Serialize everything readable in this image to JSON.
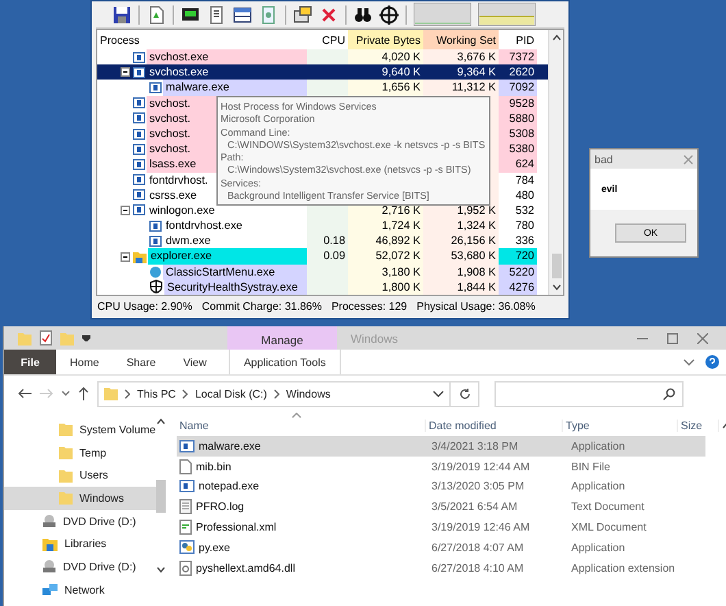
{
  "process_explorer": {
    "columns": [
      "Process",
      "CPU",
      "Private Bytes",
      "Working Set",
      "PID"
    ],
    "rows": [
      {
        "name": "svchost.exe",
        "private_bytes": "4,020 K",
        "working_set": "3,676 K",
        "pid": "7372",
        "kind": "app",
        "color": "#ffd0dc",
        "selected": false
      },
      {
        "name": "svchost.exe",
        "private_bytes": "9,640 K",
        "working_set": "9,364 K",
        "pid": "2620",
        "kind": "app",
        "selected": true,
        "expanded": true,
        "children": [
          {
            "name": "malware.exe",
            "private_bytes": "1,656 K",
            "working_set": "11,312 K",
            "pid": "7092",
            "kind": "app",
            "color": "#d4d4ff",
            "selected": false
          }
        ]
      },
      {
        "name": "svchost.",
        "pid": "9528",
        "kind": "app",
        "color": "#ffd0dc",
        "selected": false
      },
      {
        "name": "svchost.",
        "pid": "5880",
        "kind": "app",
        "color": "#ffd0dc",
        "selected": false
      },
      {
        "name": "svchost.",
        "pid": "5308",
        "kind": "app",
        "color": "#ffd0dc",
        "selected": false
      },
      {
        "name": "svchost.",
        "pid": "5380",
        "kind": "app",
        "color": "#ffd0dc",
        "selected": false
      },
      {
        "name": "lsass.exe",
        "pid": "624",
        "kind": "app",
        "color": "#ffd0dc",
        "selected": false
      },
      {
        "name": "fontdrvhost.",
        "pid": "784",
        "kind": "app",
        "selected": false
      },
      {
        "name": "csrss.exe",
        "pid": "480",
        "kind": "app",
        "selected": false
      },
      {
        "name": "winlogon.exe",
        "private_bytes": "2,716 K",
        "working_set": "1,952 K",
        "pid": "532",
        "kind": "app",
        "selected": false,
        "expanded": true,
        "children": [
          {
            "name": "fontdrvhost.exe",
            "private_bytes": "1,724 K",
            "working_set": "1,324 K",
            "pid": "780",
            "kind": "app",
            "selected": false
          },
          {
            "name": "dwm.exe",
            "cpu": "0.18",
            "private_bytes": "46,892 K",
            "working_set": "26,156 K",
            "pid": "336",
            "kind": "app",
            "selected": false
          }
        ]
      },
      {
        "name": "explorer.exe",
        "cpu": "0.09",
        "private_bytes": "52,072 K",
        "working_set": "53,680 K",
        "pid": "720",
        "kind": "folder",
        "color": "#00e6e6",
        "selected": false,
        "expanded": true,
        "children": [
          {
            "name": "ClassicStartMenu.exe",
            "private_bytes": "3,180 K",
            "working_set": "1,908 K",
            "pid": "5220",
            "kind": "orb",
            "color": "#d4d4ff",
            "selected": false
          },
          {
            "name": "SecurityHealthSystray.exe",
            "private_bytes": "1,800 K",
            "working_set": "1,844 K",
            "pid": "4276",
            "kind": "shield",
            "color": "#d4d4ff",
            "selected": false
          }
        ]
      }
    ],
    "tooltip": [
      {
        "text": "Host Process for Windows Services",
        "kind": "label"
      },
      {
        "text": "Microsoft Corporation",
        "kind": "label"
      },
      {
        "text": "Command Line:",
        "kind": "label"
      },
      {
        "text": "C:\\WINDOWS\\System32\\svchost.exe -k netsvcs -p -s BITS",
        "kind": "detail"
      },
      {
        "text": "Path:",
        "kind": "label"
      },
      {
        "text": "C:\\Windows\\System32\\svchost.exe (netsvcs -p -s BITS)",
        "kind": "detail"
      },
      {
        "text": "Services:",
        "kind": "label"
      },
      {
        "text": "Background Intelligent Transfer Service [BITS]",
        "kind": "detail"
      }
    ],
    "status_bar": [
      "CPU Usage: 2.90%",
      "Commit Charge: 31.86%",
      "Processes: 129",
      "Physical Usage: 36.08%"
    ]
  },
  "dialog": {
    "title": "bad",
    "message": "evil",
    "button": "OK"
  },
  "explorer": {
    "title": "Windows",
    "context_tab": "Manage",
    "ribbon_tabs": [
      {
        "label": "File",
        "kind": "file"
      },
      {
        "label": "Home",
        "kind": "tab"
      },
      {
        "label": "Share",
        "kind": "tab"
      },
      {
        "label": "View",
        "kind": "tab"
      },
      {
        "label": "Application Tools",
        "kind": "context"
      }
    ],
    "breadcrumb": [
      "This PC",
      "Local Disk (C:)",
      "Windows"
    ],
    "nav": [
      {
        "label": "System Volume",
        "kind": "folder",
        "selected": false
      },
      {
        "label": "Temp",
        "kind": "folder",
        "selected": false
      },
      {
        "label": "Users",
        "kind": "folder",
        "selected": false
      },
      {
        "label": "Windows",
        "kind": "folder",
        "selected": true
      },
      {
        "label": "DVD Drive (D:)",
        "kind": "drive",
        "selected": false
      },
      {
        "label": "Libraries",
        "kind": "library",
        "selected": false
      },
      {
        "label": "DVD Drive (D:)",
        "kind": "drive",
        "selected": false
      },
      {
        "label": "Network",
        "kind": "network",
        "selected": false
      }
    ],
    "columns": [
      "Name",
      "Date modified",
      "Type",
      "Size"
    ],
    "files": [
      {
        "name": "malware.exe",
        "date": "3/4/2021 3:18 PM",
        "type": "Application",
        "kind": "app",
        "selected": true
      },
      {
        "name": "mib.bin",
        "date": "3/19/2019 12:44 AM",
        "type": "BIN File",
        "kind": "blank",
        "selected": false
      },
      {
        "name": "notepad.exe",
        "date": "3/13/2020 3:05 PM",
        "type": "Application",
        "kind": "app",
        "selected": false
      },
      {
        "name": "PFRO.log",
        "date": "3/5/2021 6:54 AM",
        "type": "Text Document",
        "kind": "text",
        "selected": false
      },
      {
        "name": "Professional.xml",
        "date": "3/19/2019 12:46 AM",
        "type": "XML Document",
        "kind": "xml",
        "selected": false
      },
      {
        "name": "py.exe",
        "date": "6/27/2018 4:07 AM",
        "type": "Application",
        "kind": "python",
        "selected": false
      },
      {
        "name": "pyshellext.amd64.dll",
        "date": "6/27/2018 4:10 AM",
        "type": "Application extension",
        "kind": "dll",
        "selected": false
      }
    ]
  }
}
